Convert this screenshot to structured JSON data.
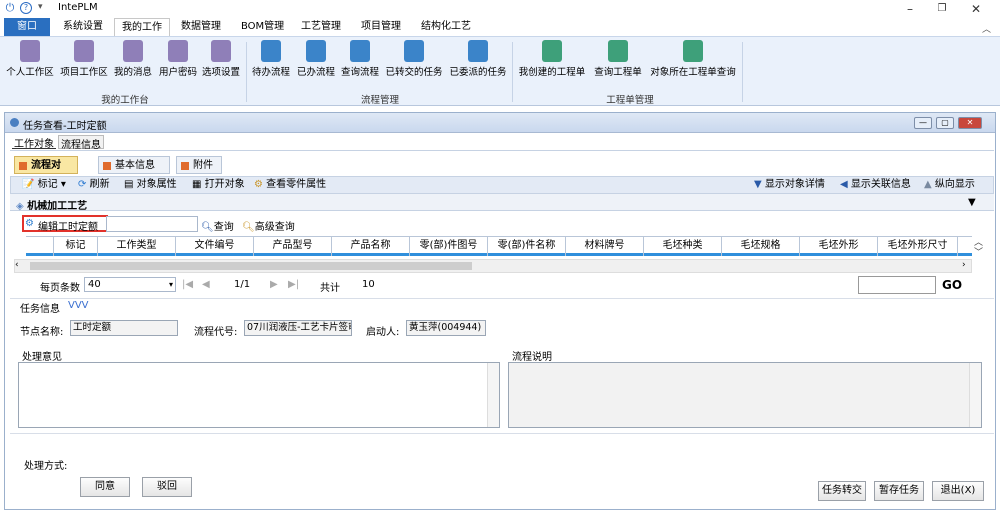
{
  "app": {
    "title": "IntePLM"
  },
  "menu": {
    "window": "窗口",
    "tabs": [
      "系统设置",
      "我的工作",
      "数据管理",
      "BOM管理",
      "工艺管理",
      "项目管理",
      "结构化工艺"
    ]
  },
  "ribbon": {
    "groups": [
      "我的工作台",
      "流程管理",
      "工程单管理"
    ],
    "items": [
      "个人工作区",
      "项目工作区",
      "我的消息",
      "用户密码",
      "选项设置",
      "待办流程",
      "已办流程",
      "查询流程",
      "已转交的任务",
      "已委派的任务",
      "我创建的工程单",
      "查询工程单",
      "对象所在工程单查询"
    ]
  },
  "window": {
    "title": "任务查看-工时定额",
    "top_tabs": [
      "工作对象",
      "流程信息"
    ]
  },
  "panel_tabs": [
    "流程对象",
    "基本信息",
    "附件"
  ],
  "toolbar": {
    "left": [
      "标记",
      "刷新",
      "对象属性",
      "打开对象",
      "查看零件属性"
    ],
    "right": [
      "显示对象详情",
      "显示关联信息",
      "纵向显示"
    ]
  },
  "section": {
    "title": "机械加工工艺"
  },
  "edit": {
    "label": "编辑工时定额",
    "search": "查询",
    "advanced": "高级查询"
  },
  "grid": {
    "columns": [
      "标记",
      "工作类型",
      "文件编号",
      "产品型号",
      "产品名称",
      "零(部)件图号",
      "零(部)件名称",
      "材料牌号",
      "毛坯种类",
      "毛坯规格",
      "毛坯外形",
      "毛坯外形尺寸"
    ]
  },
  "pager": {
    "per_page_label": "每页条数",
    "per_page": "40",
    "page": "1/1",
    "total_label": "共计",
    "total": "10",
    "go": "GO"
  },
  "task": {
    "title": "任务信息",
    "toggle": "VVV",
    "node_label": "节点名称:",
    "node_value": "工时定额",
    "code_label": "流程代号:",
    "code_value": "07川润液压-工艺卡片签审",
    "starter_label": "启动人:",
    "starter_value": "黄玉萍(004944)",
    "opinion_label": "处理意见",
    "desc_label": "流程说明",
    "method_label": "处理方式:",
    "agree": "同意",
    "reject": "驳回",
    "transfer": "任务转交",
    "save": "暂存任务",
    "exit": "退出(X)"
  }
}
